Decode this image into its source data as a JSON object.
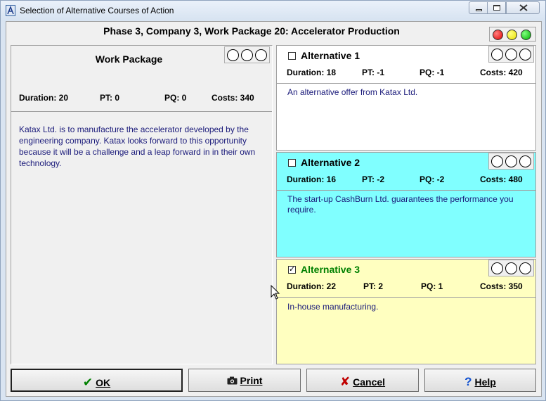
{
  "window": {
    "title": "Selection of Alternative Courses of Action"
  },
  "header": {
    "phase_title": "Phase 3, Company 3, Work Package 20: Accelerator Production"
  },
  "work_package": {
    "heading": "Work Package",
    "duration": "Duration: 20",
    "pt": "PT: 0",
    "pq": "PQ: 0",
    "costs": "Costs: 340",
    "description": "Katax Ltd. is to manufacture the accelerator developed by the engineering company. Katax looks forward to this opportunity because it will be a challenge and a leap forward in in their own technology."
  },
  "alternatives": [
    {
      "title": "Alternative 1",
      "checked": false,
      "duration": "Duration: 18",
      "pt": "PT: -1",
      "pq": "PQ: -1",
      "costs": "Costs: 420",
      "description": "An alternative offer from Katax Ltd.",
      "color": "#ffffff"
    },
    {
      "title": "Alternative 2",
      "checked": false,
      "duration": "Duration: 16",
      "pt": "PT: -2",
      "pq": "PQ: -2",
      "costs": "Costs: 480",
      "description": "The start-up CashBurn Ltd. guarantees the performance you require.",
      "color": "#80ffff"
    },
    {
      "title": "Alternative 3",
      "checked": true,
      "duration": "Duration: 22",
      "pt": "PT: 2",
      "pq": "PQ: 1",
      "costs": "Costs: 350",
      "description": "In-house manufacturing.",
      "color": "#ffffc0"
    }
  ],
  "traffic_lights": [
    "#e00000",
    "#e8e000",
    "#00b000"
  ],
  "buttons": {
    "ok": "OK",
    "print": "Print",
    "cancel": "Cancel",
    "help": "Help"
  }
}
